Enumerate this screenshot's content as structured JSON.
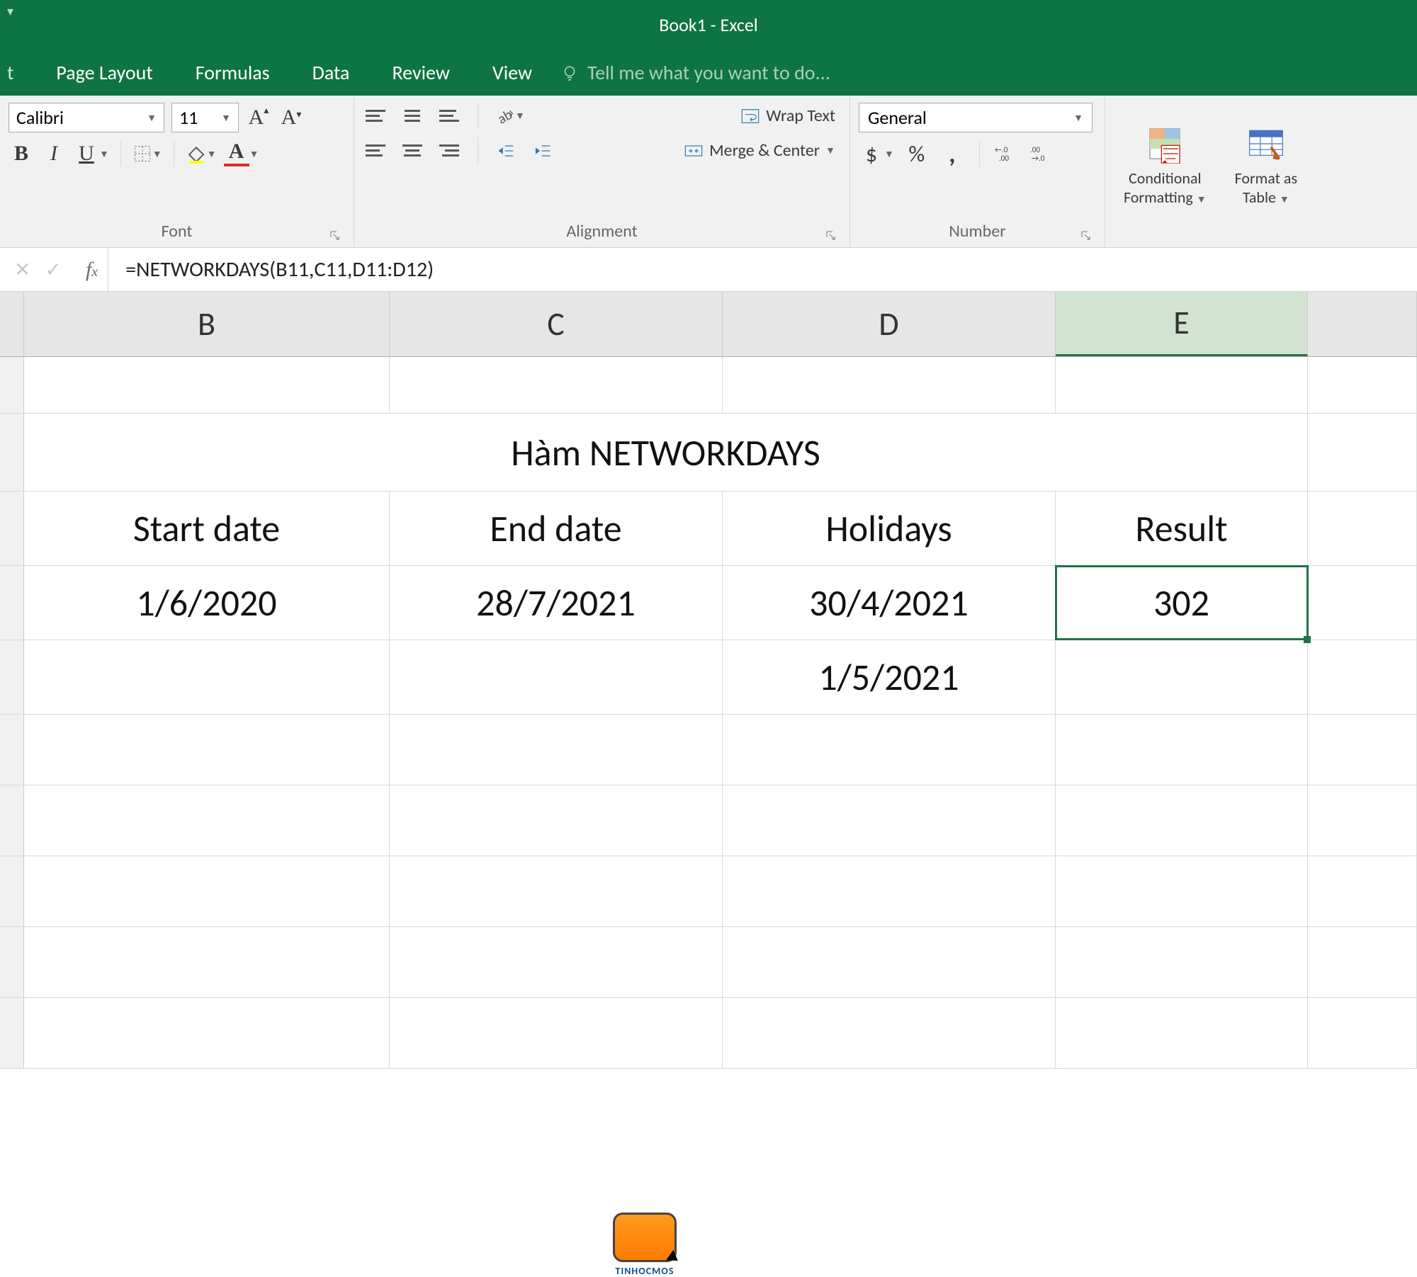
{
  "app": {
    "title": "Book1 - Excel"
  },
  "tabs": {
    "page_layout": "Page Layout",
    "formulas": "Formulas",
    "data": "Data",
    "review": "Review",
    "view": "View",
    "tell_me": "Tell me what you want to do..."
  },
  "ribbon": {
    "font": {
      "name": "Calibri",
      "size": "11",
      "group_label": "Font"
    },
    "alignment": {
      "wrap_text": "Wrap Text",
      "merge_center": "Merge & Center",
      "group_label": "Alignment"
    },
    "number": {
      "format": "General",
      "group_label": "Number"
    },
    "styles": {
      "conditional_line1": "Conditional",
      "conditional_line2": "Formatting",
      "format_table_line1": "Format as",
      "format_table_line2": "Table"
    }
  },
  "formula_bar": {
    "formula": "=NETWORKDAYS(B11,C11,D11:D12)"
  },
  "columns": {
    "A": "",
    "B": "B",
    "C": "C",
    "D": "D",
    "E": "E"
  },
  "sheet": {
    "title_row": "Hàm NETWORKDAYS",
    "headers": {
      "b": "Start date",
      "c": "End date",
      "d": "Holidays",
      "e": "Result"
    },
    "data": {
      "b11": "1/6/2020",
      "c11": "28/7/2021",
      "d11": "30/4/2021",
      "d12": "1/5/2021",
      "e11": "302"
    }
  },
  "watermark": "TINHOCMOS"
}
